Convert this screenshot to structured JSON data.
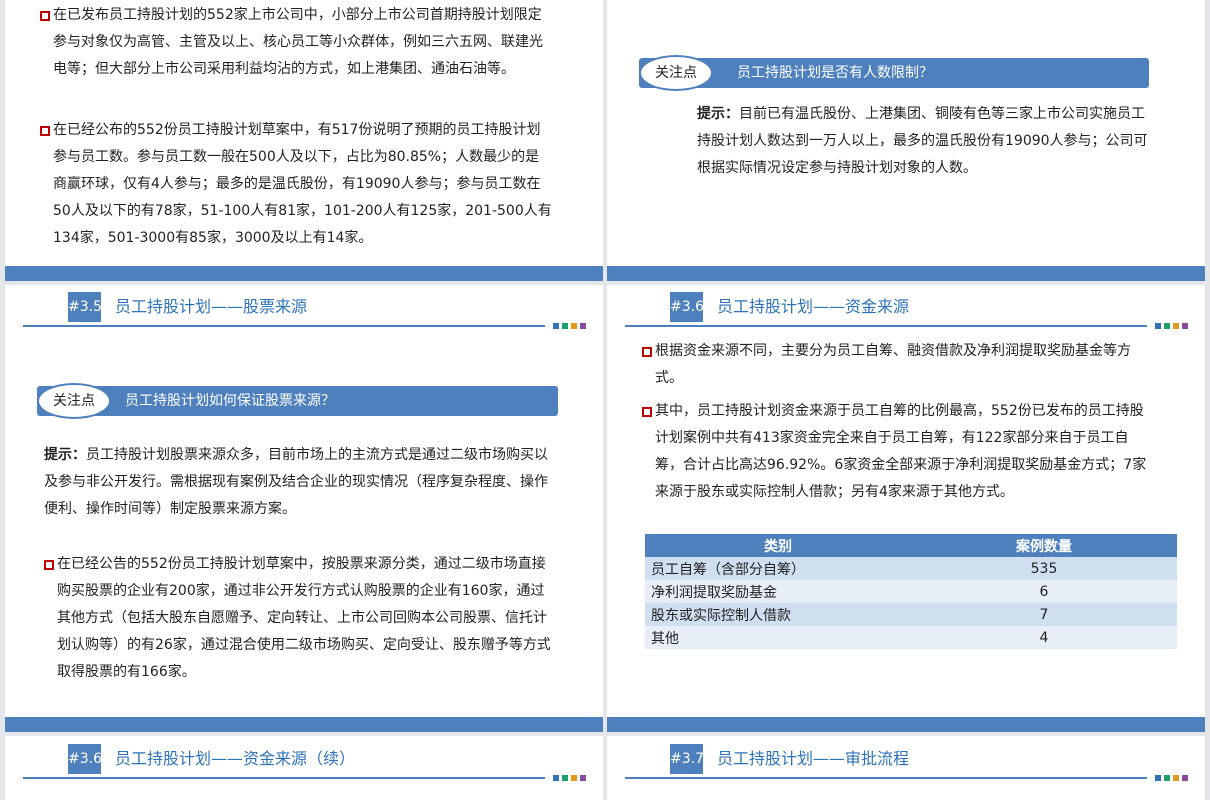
{
  "slide1": {
    "bullets": [
      "在已发布员工持股计划的552家上市公司中，小部分上市公司首期持股计划限定参与对象仅为高管、主管及以上、核心员工等小众群体，例如三六五网、联建光电等；但大部分上市公司采用利益均沾的方式，如上港集团、通油石油等。",
      "在已经公布的552份员工持股计划草案中，有517份说明了预期的员工持股计划参与员工数。参与员工数一般在500人及以下，占比为80.85%；人数最少的是商赢环球，仅有4人参与；最多的是温氏股份，有19090人参与；参与员工数在50人及以下的有78家，51-100人有81家，101-200人有125家，201-500人有134家，501-3000有85家，3000及以上有14家。"
    ]
  },
  "slide2": {
    "label": "关注点",
    "question": "员工持股计划是否有人数限制？",
    "hint_prefix": "提示：",
    "hint_text": "目前已有温氏股份、上港集团、铜陵有色等三家上市公司实施员工持股计划人数达到一万人以上，最多的温氏股份有19090人参与；公司可根据实际情况设定参与持股计划对象的人数。"
  },
  "slide3": {
    "num": "#3.5",
    "title": "员工持股计划——股票来源",
    "label": "关注点",
    "question": "员工持股计划如何保证股票来源？",
    "hint_prefix": "提示：",
    "hint_text": "员工持股计划股票来源众多，目前市场上的主流方式是通过二级市场购买以及参与非公开发行。需根据现有案例及结合企业的现实情况（程序复杂程度、操作便利、操作时间等）制定股票来源方案。",
    "bullet": "在已经公告的552份员工持股计划草案中，按股票来源分类，通过二级市场直接购买股票的企业有200家，通过非公开发行方式认购股票的企业有160家，通过其他方式（包括大股东自愿赠予、定向转让、上市公司回购本公司股票、信托计划认购等）的有26家，通过混合使用二级市场购买、定向受让、股东赠予等方式取得股票的有166家。"
  },
  "slide4": {
    "num": "#3.6",
    "title": "员工持股计划——资金来源",
    "bullets": [
      "根据资金来源不同，主要分为员工自筹、融资借款及净利润提取奖励基金等方式。",
      "其中，员工持股计划资金来源于员工自筹的比例最高，552份已发布的员工持股计划案例中共有413家资金完全来自于员工自筹，有122家部分来自于员工自筹，合计占比高达96.92%。6家资金全部来源于净利润提取奖励基金方式；7家来源于股东或实际控制人借款；另有4家来源于其他方式。"
    ],
    "table": {
      "headers": [
        "类别",
        "案例数量"
      ],
      "rows": [
        [
          "员工自筹（含部分自筹）",
          "535"
        ],
        [
          "净利润提取奖励基金",
          "6"
        ],
        [
          "股东或实际控制人借款",
          "7"
        ],
        [
          "其他",
          "4"
        ]
      ]
    }
  },
  "slide5": {
    "num": "#3.6",
    "title": "员工持股计划——资金来源（续）"
  },
  "slide6": {
    "num": "#3.7",
    "title": "员工持股计划——审批流程"
  },
  "colors": {
    "accent": "#4e80bd",
    "marker": "#c00000",
    "title": "#2e73b8"
  },
  "deco_dots": [
    "#2e73b8",
    "#1e9e6a",
    "#e39b1f",
    "#8a4aa0"
  ]
}
